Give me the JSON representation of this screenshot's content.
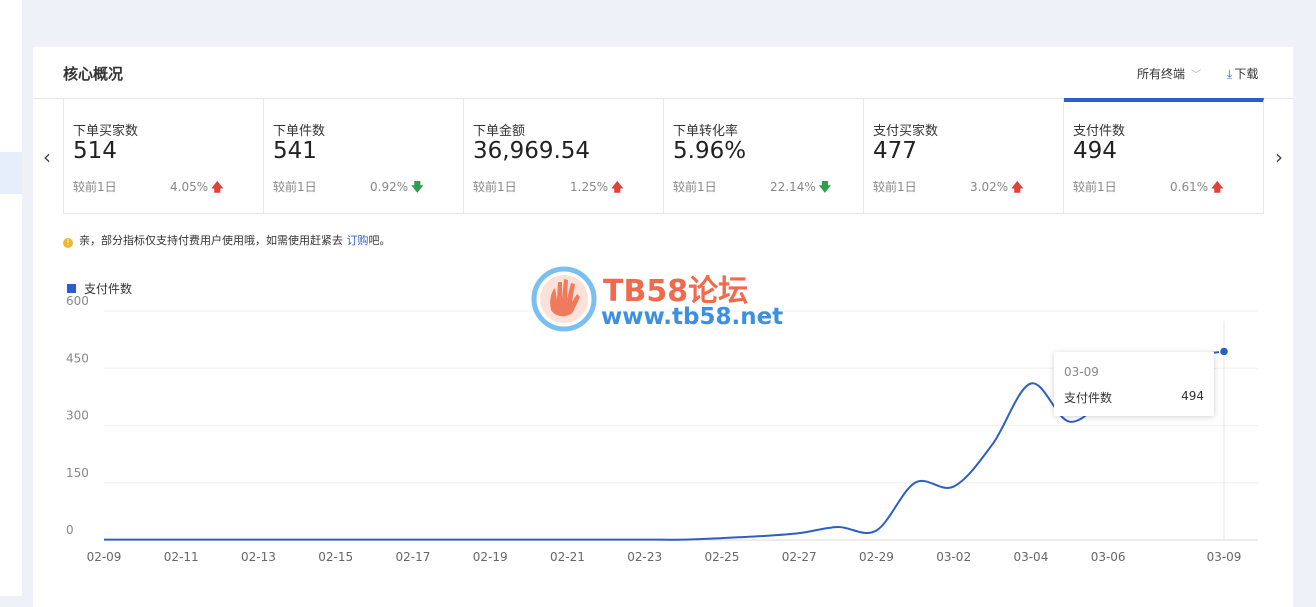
{
  "card": {
    "title": "核心概况",
    "terminal_select": "所有终端",
    "download_label": "下载"
  },
  "metrics": [
    {
      "label": "下单买家数",
      "value": "514",
      "compare": "较前1日",
      "pct": "4.05%",
      "trend": "up"
    },
    {
      "label": "下单件数",
      "value": "541",
      "compare": "较前1日",
      "pct": "0.92%",
      "trend": "down"
    },
    {
      "label": "下单金额",
      "value": "36,969.54",
      "compare": "较前1日",
      "pct": "1.25%",
      "trend": "up"
    },
    {
      "label": "下单转化率",
      "value": "5.96%",
      "compare": "较前1日",
      "pct": "22.14%",
      "trend": "down"
    },
    {
      "label": "支付买家数",
      "value": "477",
      "compare": "较前1日",
      "pct": "3.02%",
      "trend": "up"
    },
    {
      "label": "支付件数",
      "value": "494",
      "compare": "较前1日",
      "pct": "0.61%",
      "trend": "up",
      "active": true
    }
  ],
  "notice": {
    "text": "亲，部分指标仅支持付费用户使用哦，如需使用赶紧去",
    "link": "订购",
    "suffix": "吧。"
  },
  "watermark": {
    "title": "TB58论坛",
    "url": "www.tb58.net"
  },
  "colors": {
    "accent": "#2c5fc4",
    "up": "#e0413a",
    "down": "#2e9e4f"
  },
  "chart_data": {
    "type": "line",
    "x": [
      "02-09",
      "02-10",
      "02-11",
      "02-12",
      "02-13",
      "02-14",
      "02-15",
      "02-16",
      "02-17",
      "02-18",
      "02-19",
      "02-20",
      "02-21",
      "02-22",
      "02-23",
      "02-24",
      "02-25",
      "02-26",
      "02-27",
      "02-28",
      "02-29",
      "03-01",
      "03-02",
      "03-03",
      "03-04",
      "03-05",
      "03-06",
      "03-07",
      "03-08",
      "03-09"
    ],
    "x_ticks": [
      "02-09",
      "02-11",
      "02-13",
      "02-15",
      "02-17",
      "02-19",
      "02-21",
      "02-23",
      "02-25",
      "02-27",
      "02-29",
      "03-02",
      "03-04",
      "03-06",
      "03-09"
    ],
    "series": [
      {
        "name": "支付件数",
        "values": [
          1,
          1,
          1,
          1,
          1,
          1,
          1,
          1,
          1,
          1,
          1,
          1,
          1,
          1,
          1,
          1,
          5,
          10,
          18,
          34,
          25,
          150,
          140,
          250,
          410,
          310,
          380,
          470,
          482,
          494
        ]
      }
    ],
    "ylim": [
      0,
      600
    ],
    "y_ticks": [
      0,
      150,
      300,
      450,
      600
    ],
    "grid": true,
    "legend": "top-left",
    "tooltip": {
      "date": "03-09",
      "name": "支付件数",
      "value": "494"
    }
  }
}
